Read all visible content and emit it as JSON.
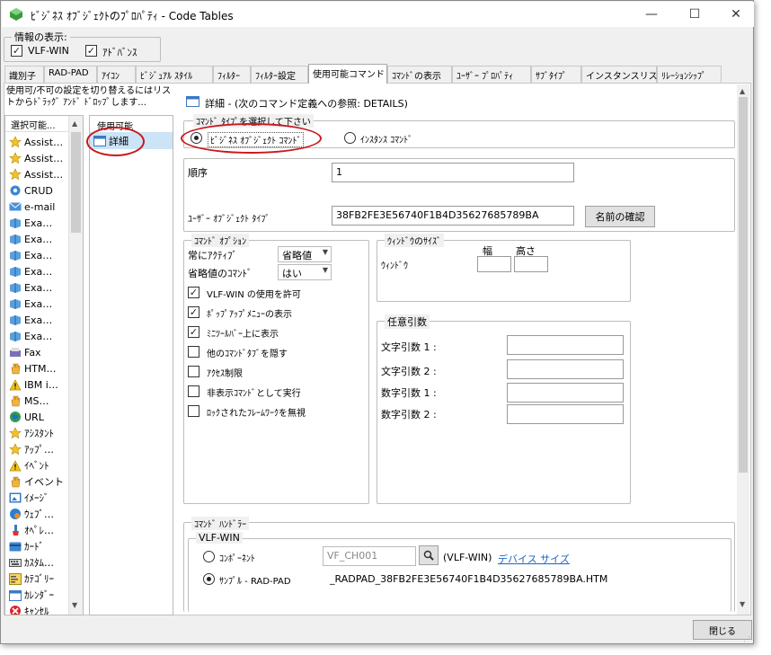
{
  "window": {
    "title": "ﾋﾞｼﾞﾈｽ ｵﾌﾞｼﾞｪｸﾄのﾌﾟﾛﾊﾟﾃｨ - Code Tables",
    "minimize": "—",
    "maximize": "☐",
    "close": "✕"
  },
  "display_options": {
    "label": "情報の表示:",
    "vlf_win": "VLF-WIN",
    "advanced": "ｱﾄﾞﾊﾞﾝｽ"
  },
  "tabs": [
    "識別子",
    "RAD-PAD",
    "ｱｲｺﾝ",
    "ﾋﾞｼﾞｭｱﾙ ｽﾀｲﾙ",
    "ﾌｨﾙﾀｰ",
    "ﾌｨﾙﾀｰ設定",
    "使用可能コマンド",
    "ｺﾏﾝﾄﾞの表示",
    "ﾕｰｻﾞｰ ﾌﾟﾛﾊﾟﾃｨ",
    "ｻﾌﾞﾀｲﾌﾟ",
    "インスタンスリスト",
    "ﾘﾚｰｼｮﾝｼｯﾌﾟ"
  ],
  "left": {
    "instruction": "使用可/不可の設定を切り替えるにはリストからﾄﾞﾗｯｸﾞ ｱﾝﾄﾞ ﾄﾞﾛｯﾌﾟします...",
    "selectable_header": "選択可能...",
    "items": [
      {
        "label": "Assist…",
        "icon": "star-icon"
      },
      {
        "label": "Assist…",
        "icon": "star-icon"
      },
      {
        "label": "Assist…",
        "icon": "star-icon"
      },
      {
        "label": "CRUD",
        "icon": "gear-icon"
      },
      {
        "label": "e-mail",
        "icon": "email-icon"
      },
      {
        "label": "Exa…",
        "icon": "book-icon"
      },
      {
        "label": "Exa…",
        "icon": "book-icon"
      },
      {
        "label": "Exa…",
        "icon": "book-icon"
      },
      {
        "label": "Exa…",
        "icon": "book-icon"
      },
      {
        "label": "Exa…",
        "icon": "book-icon"
      },
      {
        "label": "Exa…",
        "icon": "book-icon"
      },
      {
        "label": "Exa…",
        "icon": "book-icon"
      },
      {
        "label": "Exa…",
        "icon": "book-icon"
      },
      {
        "label": "Fax",
        "icon": "fax-icon"
      },
      {
        "label": "HTM…",
        "icon": "hand-icon"
      },
      {
        "label": "IBM i…",
        "icon": "warning-icon"
      },
      {
        "label": "MS…",
        "icon": "hand-icon"
      },
      {
        "label": "URL",
        "icon": "globe-icon"
      },
      {
        "label": "ｱｼｽﾀﾝﾄ",
        "icon": "star-icon"
      },
      {
        "label": "ｱｯﾌﾟ…",
        "icon": "star-icon"
      },
      {
        "label": "ｲﾍﾞﾝﾄ",
        "icon": "warning-icon"
      },
      {
        "label": "イベント",
        "icon": "hand-icon"
      },
      {
        "label": "ｲﾒｰｼﾞ",
        "icon": "image-icon"
      },
      {
        "label": "ｳｪﾌﾞ…",
        "icon": "web-icon"
      },
      {
        "label": "ｵﾍﾟﾚ…",
        "icon": "brush-icon"
      },
      {
        "label": "ｶｰﾄﾞ",
        "icon": "card-icon"
      },
      {
        "label": "ｶｽﾀﾑ…",
        "icon": "keyboard-icon"
      },
      {
        "label": "ｶﾃｺﾞﾘｰ",
        "icon": "category-icon"
      },
      {
        "label": "ｶﾚﾝﾀﾞｰ",
        "icon": "calendar-icon"
      },
      {
        "label": "ｷｬﾝｾﾙ",
        "icon": "cancel-icon"
      }
    ],
    "enabled_header": "使用可能",
    "enabled_items": [
      {
        "label": "詳細",
        "icon": "window-icon"
      }
    ]
  },
  "detail": {
    "header": "詳細 - (次のコマンド定義への参照: DETAILS)",
    "command_type_legend": "ｺﾏﾝﾄﾞ ﾀｲﾌﾟを選択して下さい",
    "business_object_command": "ﾋﾞｼﾞﾈｽ ｵﾌﾞｼﾞｪｸﾄ ｺﾏﾝﾄﾞ",
    "instance_command": "ｲﾝｽﾀﾝｽ ｺﾏﾝﾄﾞ",
    "sequence_label": "順序",
    "sequence_value": "1",
    "user_object_type_label": "ﾕｰｻﾞｰ ｵﾌﾞｼﾞｪｸﾄ ﾀｲﾌﾟ",
    "user_object_type_value": "38FB2FE3E56740F1B4D35627685789BA",
    "confirm_name_button": "名前の確認",
    "options": {
      "legend": "ｺﾏﾝﾄﾞ ｵﾌﾟｼｮﾝ",
      "always_active_label": "常にｱｸﾃｨﾌﾞ",
      "always_active_value": "省略値",
      "default_command_label": "省略値のｺﾏﾝﾄﾞ",
      "default_command_value": "はい",
      "checks": [
        {
          "label": "VLF-WIN の使用を許可",
          "checked": true
        },
        {
          "label": "ﾎﾟｯﾌﾟｱｯﾌﾟﾒﾆｭｰの表示",
          "checked": true
        },
        {
          "label": "ﾐﾆﾂｰﾙﾊﾞｰ上に表示",
          "checked": true
        },
        {
          "label": "他のｺﾏﾝﾄﾞﾀﾌﾞを隠す",
          "checked": false
        },
        {
          "label": "ｱｸｾｽ制限",
          "checked": false
        },
        {
          "label": "非表示ｺﾏﾝﾄﾞとして実行",
          "checked": false
        },
        {
          "label": "ﾛｯｸされたﾌﾚｰﾑﾜｰｸを無視",
          "checked": false
        }
      ]
    },
    "window_size": {
      "legend": "ｳｨﾝﾄﾞｳのｻｲｽﾞ",
      "width_label": "幅",
      "height_label": "高さ",
      "window_label": "ｳｨﾝﾄﾞｳ"
    },
    "optional_args": {
      "legend": "任意引数",
      "labels": [
        "文字引数 1 :",
        "文字引数 2 :",
        "数字引数 1 :",
        "数字引数 2 :"
      ]
    },
    "handler": {
      "legend": "ｺﾏﾝﾄﾞ ﾊﾝﾄﾞﾗｰ",
      "vlf_win_legend": "VLF-WIN",
      "component_label": "ｺﾝﾎﾟｰﾈﾝﾄ",
      "component_value": "VF_CH001",
      "vlf_win_suffix": "(VLF-WIN)",
      "device_size_link": "デバイス サイズ",
      "sample_label": "ｻﾝﾌﾟﾙ - RAD-PAD",
      "sample_value": "_RADPAD_38FB2FE3E56740F1B4D35627685789BA.HTM"
    }
  },
  "footer": {
    "close_button": "閉じる"
  },
  "colors": {
    "annotation": "#c8191f",
    "link": "#1a66c7",
    "selection": "#cce4f7"
  }
}
